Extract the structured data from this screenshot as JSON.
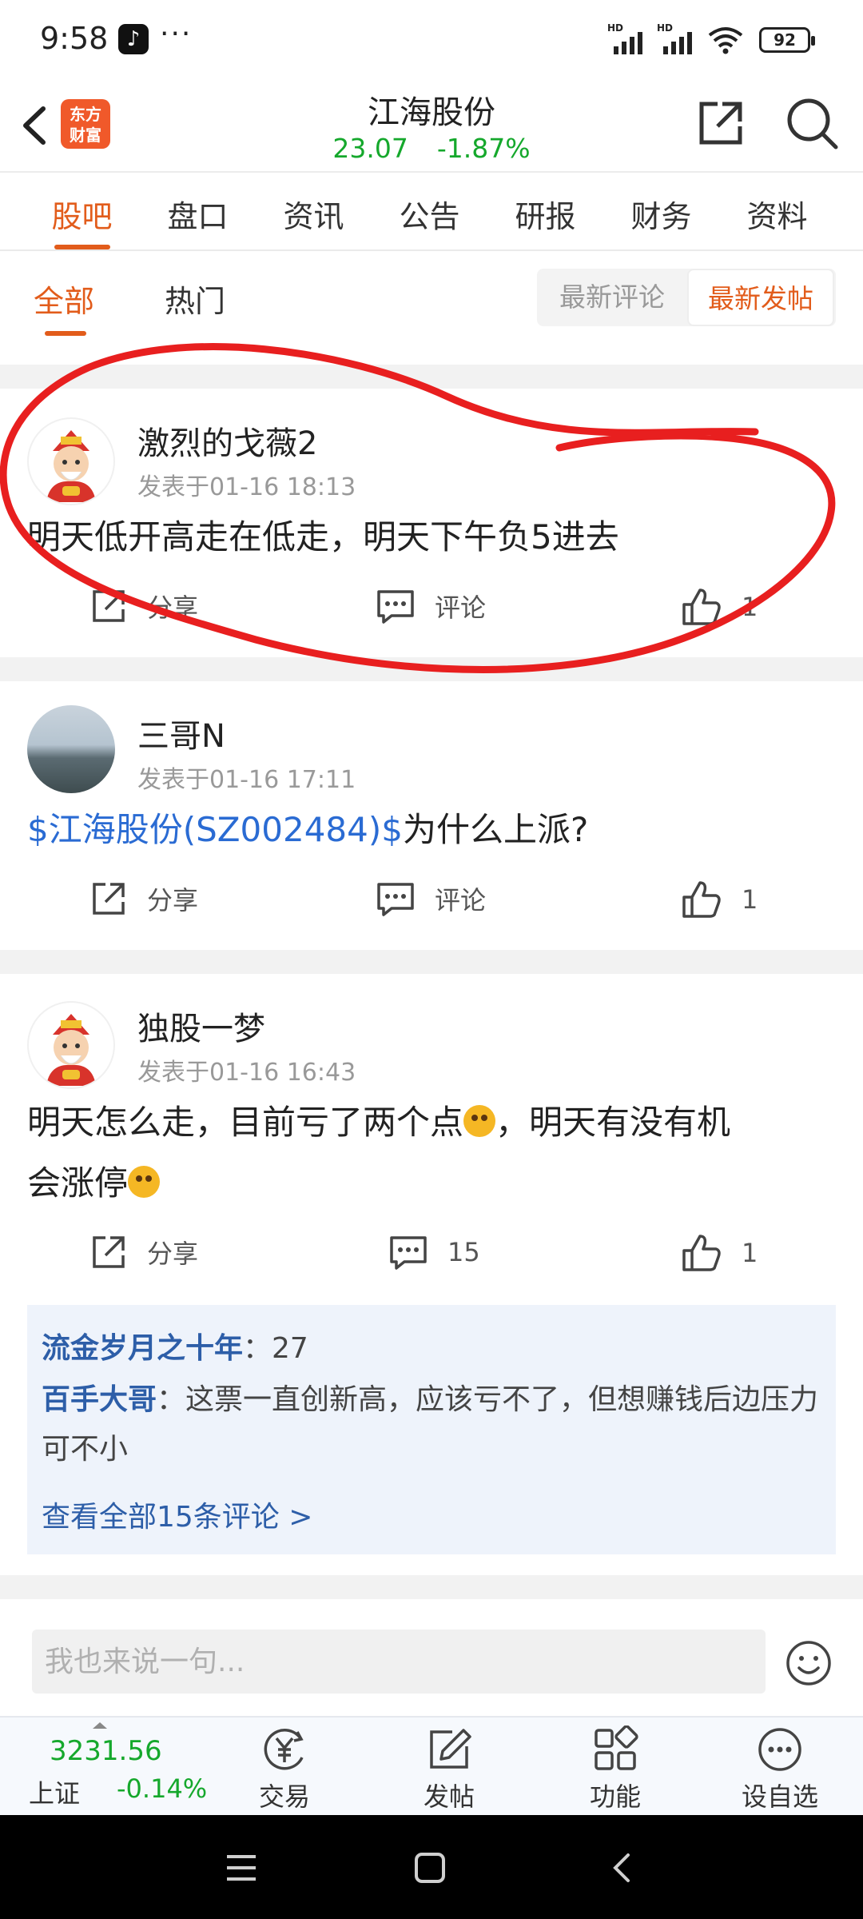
{
  "status_bar": {
    "time": "9:58",
    "app_icon": "tiktok-icon",
    "more": "···",
    "signal_label": "HD",
    "battery": "92"
  },
  "header": {
    "logo_line1": "东方",
    "logo_line2": "财富",
    "stock_name": "江海股份",
    "price": "23.07",
    "change": "-1.87%",
    "price_color": "#15a82c"
  },
  "main_tabs": [
    {
      "label": "股吧",
      "active": true
    },
    {
      "label": "盘口"
    },
    {
      "label": "资讯"
    },
    {
      "label": "公告"
    },
    {
      "label": "研报"
    },
    {
      "label": "财务"
    },
    {
      "label": "资料"
    }
  ],
  "sub_tabs": {
    "all": "全部",
    "hot": "热门",
    "latest_comment": "最新评论",
    "latest_post": "最新发帖"
  },
  "posts": [
    {
      "username": "激烈的戈薇2",
      "time": "发表于01-16 18:13",
      "body": "明天低开高走在低走，明天下午负5进去",
      "share": "分享",
      "comment": "评论",
      "likes": "1"
    },
    {
      "username": "三哥N",
      "time": "发表于01-16 17:11",
      "stock_tag": "$江海股份(SZ002484)$",
      "body": "为什么上派?",
      "share": "分享",
      "comment": "评论",
      "likes": "1"
    },
    {
      "username": "独股一梦",
      "time": "发表于01-16 16:43",
      "body_part1": "明天怎么走，目前亏了两个点",
      "body_part2": "，明天有没有机",
      "body_part3": "会涨停",
      "share": "分享",
      "comment": "15",
      "likes": "1",
      "comments_preview": [
        {
          "name": "流金岁月之十年",
          "text": "：27"
        },
        {
          "name": "百手大哥",
          "text": "：这票一直创新高，应该亏不了，但想赚钱后边压力可不小"
        }
      ],
      "view_all": "查看全部15条评论 >"
    }
  ],
  "comment_input": {
    "placeholder": "我也来说一句..."
  },
  "bottom_nav": {
    "index_value": "3231.56",
    "index_name": "上证",
    "index_change": "-0.14%",
    "items": [
      {
        "label": "交易",
        "icon": "trade-yen-icon"
      },
      {
        "label": "发帖",
        "icon": "compose-icon"
      },
      {
        "label": "功能",
        "icon": "apps-grid-icon"
      },
      {
        "label": "设自选",
        "icon": "more-circle-icon"
      }
    ]
  },
  "colors": {
    "accent": "#e25c1b",
    "down_green": "#15a82c",
    "link_blue": "#2a6bd3",
    "annotation_red": "#e81f1f"
  }
}
